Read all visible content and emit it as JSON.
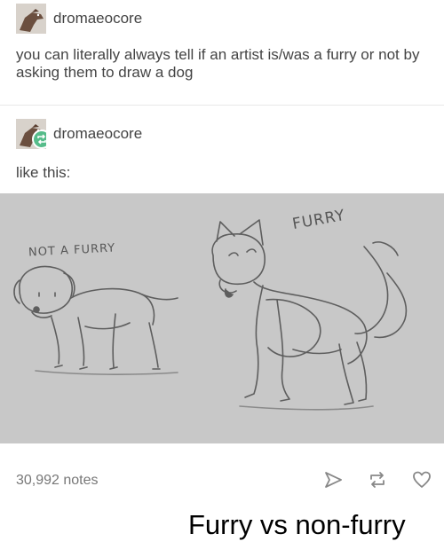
{
  "post": {
    "username": "dromaeocore",
    "text": "you can literally always tell if an artist is/was a furry or not by asking them to draw a dog",
    "avatar_icon": "dinosaur-avatar"
  },
  "reblog": {
    "username": "dromaeocore",
    "text": "like this:",
    "badge_icon": "reblog-icon",
    "badge_color": "#56bc8a"
  },
  "image": {
    "caption_left": "NOT A FURRY",
    "caption_right": "FURRY"
  },
  "footer": {
    "notes": "30,992 notes",
    "share_icon": "share-icon",
    "reblog_icon": "reblog-icon",
    "like_icon": "heart-icon"
  },
  "meme_caption": "Furry vs non-furry"
}
